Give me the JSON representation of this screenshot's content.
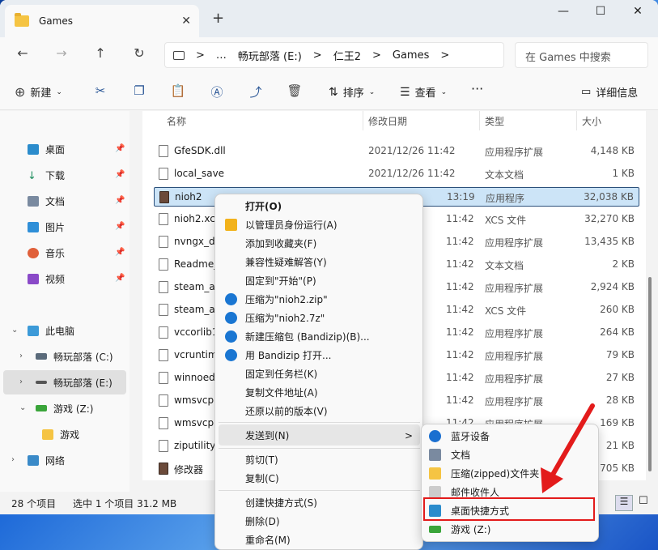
{
  "tab": {
    "title": "Games",
    "close": "✕",
    "add": "+"
  },
  "window_controls": {
    "minimize": "—",
    "maximize": "☐",
    "close": "✕"
  },
  "nav": {
    "crumbs": [
      "…",
      "畅玩部落 (E:)",
      "仁王2",
      "Games"
    ],
    "chevron": ">",
    "search_placeholder": "在 Games 中搜索"
  },
  "toolbar": {
    "new": "新建",
    "sort": "排序",
    "view": "查看",
    "more": "···",
    "details": "详细信息"
  },
  "sidebar": {
    "quick": [
      "桌面",
      "下载",
      "文档",
      "图片",
      "音乐",
      "视频"
    ],
    "this_pc": "此电脑",
    "drives": [
      "畅玩部落 (C:)",
      "畅玩部落 (E:)",
      "游戏 (Z:)"
    ],
    "sub": "游戏",
    "network": "网络"
  },
  "columns": {
    "name": "名称",
    "date": "修改日期",
    "type": "类型",
    "size": "大小"
  },
  "files": [
    {
      "name": "GfeSDK.dll",
      "date": "2021/12/26 11:42",
      "type": "应用程序扩展",
      "size": "4,148 KB"
    },
    {
      "name": "local_save",
      "date": "2021/12/26 11:42",
      "type": "文本文档",
      "size": "1 KB"
    },
    {
      "name": "nioh2",
      "date": "13:19",
      "type": "应用程序",
      "size": "32,038 KB"
    },
    {
      "name": "nioh2.xcs",
      "date": "11:42",
      "type": "XCS 文件",
      "size": "32,270 KB"
    },
    {
      "name": "nvngx_dl",
      "date": "11:42",
      "type": "应用程序扩展",
      "size": "13,435 KB"
    },
    {
      "name": "Readme_",
      "date": "11:42",
      "type": "文本文档",
      "size": "2 KB"
    },
    {
      "name": "steam_ap",
      "date": "11:42",
      "type": "应用程序扩展",
      "size": "2,924 KB"
    },
    {
      "name": "steam_ap",
      "date": "11:42",
      "type": "XCS 文件",
      "size": "260 KB"
    },
    {
      "name": "vccorlib1",
      "date": "11:42",
      "type": "应用程序扩展",
      "size": "264 KB"
    },
    {
      "name": "vcruntim",
      "date": "11:42",
      "type": "应用程序扩展",
      "size": "79 KB"
    },
    {
      "name": "winnoed",
      "date": "11:42",
      "type": "应用程序扩展",
      "size": "27 KB"
    },
    {
      "name": "wmsvcp1",
      "date": "11:42",
      "type": "应用程序扩展",
      "size": "28 KB"
    },
    {
      "name": "wmsvcp1",
      "date": "11:42",
      "type": "应用程序扩展",
      "size": "169 KB"
    },
    {
      "name": "ziputility-",
      "date": "",
      "type": "",
      "size": "21 KB"
    },
    {
      "name": "修改器",
      "date": "",
      "type": "",
      "size": "705 KB"
    }
  ],
  "status": {
    "count": "28 个项目",
    "selected": "选中 1 个项目  31.2 MB"
  },
  "context_menu": {
    "items": [
      "打开(O)",
      "以管理员身份运行(A)",
      "添加到收藏夹(F)",
      "兼容性疑难解答(Y)",
      "固定到\"开始\"(P)",
      "压缩为\"nioh2.zip\"",
      "压缩为\"nioh2.7z\"",
      "新建压缩包 (Bandizip)(B)...",
      "用 Bandizip 打开...",
      "固定到任务栏(K)",
      "复制文件地址(A)",
      "还原以前的版本(V)",
      "发送到(N)",
      "剪切(T)",
      "复制(C)",
      "创建快捷方式(S)",
      "删除(D)",
      "重命名(M)"
    ],
    "submenu_arrow": ">"
  },
  "send_to": {
    "items": [
      "蓝牙设备",
      "文档",
      "压缩(zipped)文件夹",
      "邮件收件人",
      "桌面快捷方式",
      "游戏 (Z:)"
    ]
  },
  "colors": {
    "accent": "#0067c0",
    "highlight": "#e31b1b",
    "selection": "#cce4f7"
  }
}
